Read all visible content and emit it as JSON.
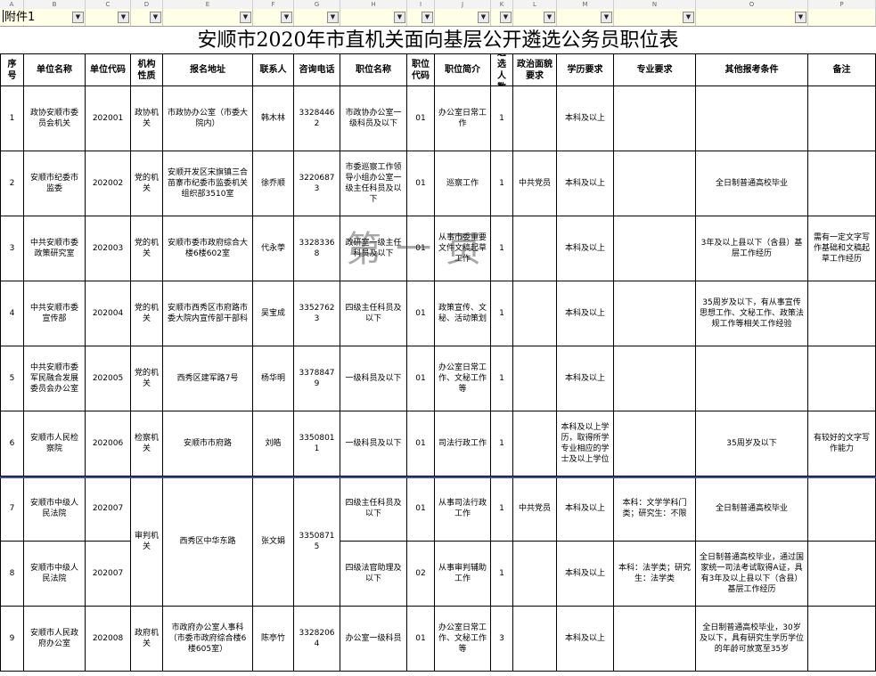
{
  "sheet": {
    "column_letters": [
      "A",
      "B",
      "C",
      "D",
      "E",
      "F",
      "G",
      "H",
      "I",
      "J",
      "K",
      "L",
      "M",
      "N",
      "O",
      "P"
    ],
    "attachment_label": "附件1",
    "title": "安顺市2020年市直机关面向基层公开遴选公务员职位表",
    "watermark": "第一页",
    "filter_icon": "dropdown-arrow-icon"
  },
  "table": {
    "headers": [
      "序号",
      "单位名称",
      "单位代码",
      "机构性质",
      "报名地址",
      "联系人",
      "咨询电话",
      "职位名称",
      "职位代码",
      "职位简介",
      "遴选人数",
      "政治面貌要求",
      "学历要求",
      "专业要求",
      "其他报考条件",
      "备注"
    ],
    "rows": [
      [
        "1",
        "政协安顺市委员会机关",
        "202001",
        "政协机关",
        "市政协办公室（市委大院内）",
        "韩木林",
        "33284462",
        "市政协办公室一级科员及以下",
        "01",
        "办公室日常工作",
        "1",
        "",
        "本科及以上",
        "",
        "",
        ""
      ],
      [
        "2",
        "安顺市纪委市监委",
        "202002",
        "党的机关",
        "安顺开发区宋旗镇三合苗寨市纪委市监委机关组织部3510室",
        "徐乔顺",
        "32206873",
        "市委巡察工作领导小组办公室一级主任科员及以下",
        "01",
        "巡察工作",
        "1",
        "中共党员",
        "本科及以上",
        "",
        "全日制普通高校毕业",
        ""
      ],
      [
        "3",
        "中共安顺市委政策研究室",
        "202003",
        "党的机关",
        "安顺市委市政府综合大楼6楼602室",
        "代永荸",
        "33283368",
        "政研室一级主任科员及以下",
        "01",
        "从事市委重要文件文稿起草工作",
        "1",
        "",
        "本科及以上",
        "",
        "3年及以上县以下（含县）基层工作经历",
        "需有一定文字写作基础和文稿起草工作经历"
      ],
      [
        "4",
        "中共安顺市委宣传部",
        "202004",
        "党的机关",
        "安顺市西秀区市府路市委大院内宣传部干部科",
        "吴宝成",
        "33527623",
        "四级主任科员及以下",
        "01",
        "政策宣传、文秘、活动策划",
        "1",
        "",
        "本科及以上",
        "",
        "35周岁及以下，有从事宣传思想工作、文秘工作、政策法规工作等相关工作经验",
        ""
      ],
      [
        "5",
        "中共安顺市委军民融合发展委员会办公室",
        "202005",
        "党的机关",
        "西秀区建军路7号",
        "杨华明",
        "33788479",
        "一级科员及以下",
        "01",
        "办公室日常工作、文秘工作等",
        "1",
        "",
        "本科及以上",
        "",
        "",
        ""
      ],
      [
        "6",
        "安顺市人民检察院",
        "202006",
        "检察机关",
        "安顺市市府路",
        "刘皓",
        "33508011",
        "一级科员及以下",
        "01",
        "司法行政工作",
        "1",
        "",
        "本科及以上学历，取得所学专业相应的学士及以上学位",
        "",
        "35周岁及以下",
        "有较好的文字写作能力"
      ],
      [
        "7",
        "安顺市中级人民法院",
        "202007",
        "审判机关",
        "西秀区中华东路",
        "张文娟",
        "33508715",
        "四级主任科员及以下",
        "01",
        "从事司法行政工作",
        "1",
        "中共党员",
        "本科及以上",
        "本科：文学学科门类；研究生：不限",
        "全日制普通高校毕业",
        ""
      ],
      [
        "8",
        "安顺市中级人民法院",
        "202007",
        "",
        "",
        "",
        "",
        "四级法官助理及以下",
        "02",
        "从事审判辅助工作",
        "1",
        "",
        "本科及以上",
        "本科：法学类；研究生：法学类",
        "全日制普通高校毕业，通过国家统一司法考试取得A证，具有3年及以上县以下（含县）基层工作经历",
        ""
      ],
      [
        "9",
        "安顺市人民政府办公室",
        "202008",
        "政府机关",
        "市政府办公室人事科（市委市政府综合楼6楼605室）",
        "陈亭竹",
        "33282064",
        "办公室一级科员",
        "01",
        "办公室日常工作、文秘工作等",
        "3",
        "",
        "本科及以上",
        "",
        "全日制普通高校毕业，30岁及以下，具有研究生学历学位的年龄可放宽至35岁",
        ""
      ]
    ]
  }
}
